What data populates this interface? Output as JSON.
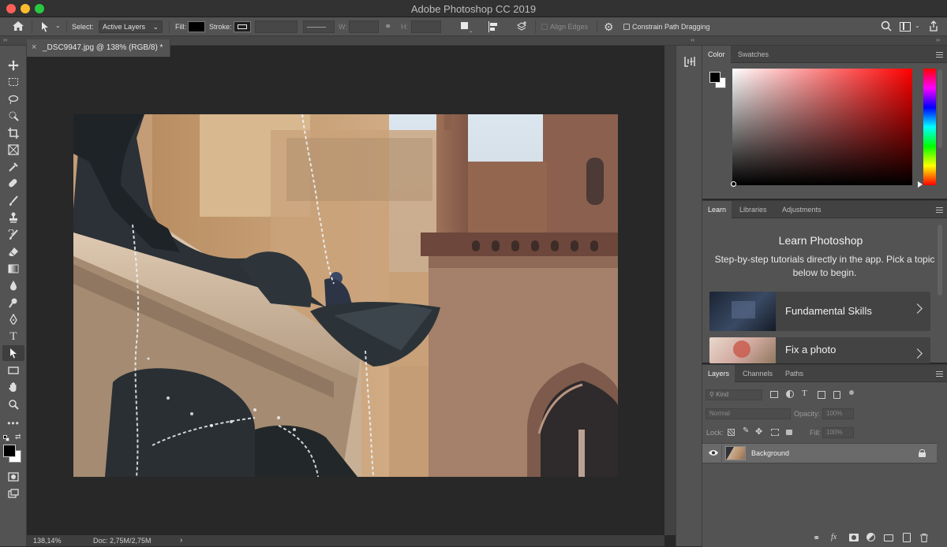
{
  "app": {
    "title": "Adobe Photoshop CC 2019"
  },
  "options_bar": {
    "select_label": "Select:",
    "select_value": "Active Layers",
    "fill_label": "Fill:",
    "stroke_label": "Stroke:",
    "w_label": "W:",
    "h_label": "H:",
    "align_edges": "Align Edges",
    "constrain_path": "Constrain Path Dragging"
  },
  "document": {
    "tab_title": "_DSC9947.jpg @ 138% (RGB/8) *"
  },
  "status_bar": {
    "zoom": "138,14%",
    "doc_info": "Doc: 2,75M/2,75M"
  },
  "color_panel": {
    "tabs": [
      "Color",
      "Swatches"
    ]
  },
  "learn_panel": {
    "tabs": [
      "Learn",
      "Libraries",
      "Adjustments"
    ],
    "heading": "Learn Photoshop",
    "description": "Step-by-step tutorials directly in the app. Pick a topic below to begin.",
    "cards": [
      "Fundamental Skills",
      "Fix a photo"
    ]
  },
  "layers_panel": {
    "tabs": [
      "Layers",
      "Channels",
      "Paths"
    ],
    "filter_kind": "Kind",
    "blend_mode": "Normal",
    "opacity_label": "Opacity:",
    "opacity_value": "100%",
    "lock_label": "Lock:",
    "fill_label": "Fill:",
    "fill_value": "100%",
    "layers": [
      {
        "name": "Background",
        "locked": true,
        "visible": true
      }
    ]
  },
  "colors": {
    "ui_dark": "#535353",
    "canvas_bg": "#282828",
    "selected_layer": "#6a6a6a"
  }
}
